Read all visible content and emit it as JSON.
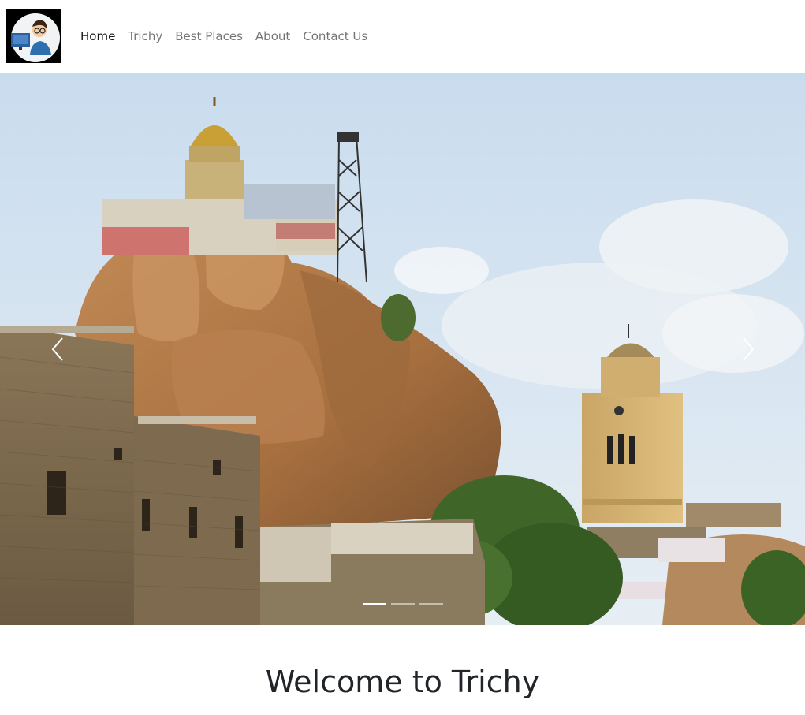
{
  "nav": {
    "logo_icon": "developer-avatar-icon",
    "links": [
      {
        "label": "Home",
        "active": true
      },
      {
        "label": "Trichy",
        "active": false
      },
      {
        "label": "Best Places",
        "active": false
      },
      {
        "label": "About",
        "active": false
      },
      {
        "label": "Contact Us",
        "active": false
      }
    ]
  },
  "carousel": {
    "slide_image": "rockfort-temple-trichy-photo",
    "prev_icon": "chevron-left-icon",
    "next_icon": "chevron-right-icon",
    "indicator_count": 3,
    "active_indicator": 0
  },
  "main": {
    "heading": "Welcome to Trichy"
  },
  "colors": {
    "text_dark": "#212529",
    "nav_inactive": "#737373",
    "sky": "#cfe0f0",
    "rock": "#b07a48",
    "fort_wall": "#7d6a4f"
  }
}
